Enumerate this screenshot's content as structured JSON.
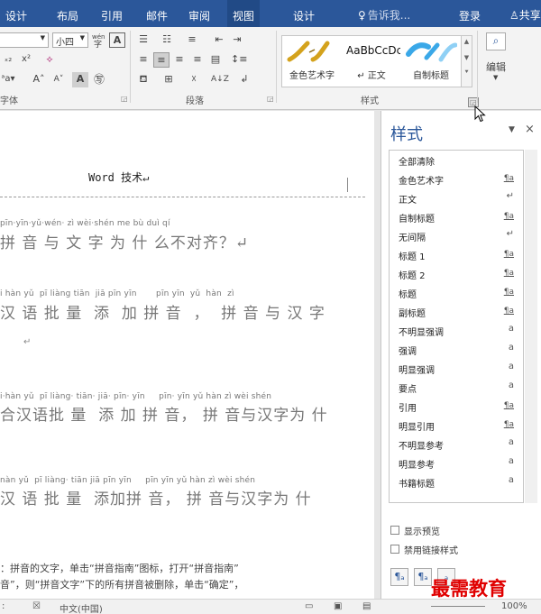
{
  "tabs": [
    "设计",
    "布局",
    "引用",
    "邮件",
    "审阅",
    "视图"
  ],
  "context_tab": "设计",
  "tell_me": {
    "icon": "lightbulb-icon",
    "placeholder": "告诉我..."
  },
  "login": "登录",
  "share": {
    "icon": "person-icon",
    "label": "共享"
  },
  "ribbon": {
    "font_size": "小四",
    "phonetic_guide": "wén",
    "char_border": "A",
    "font_group_label": "字体",
    "paragraph_group_label": "段落",
    "styles_group_label": "样式",
    "editing_label": "编辑",
    "gallery": [
      {
        "caption": "金色艺术字",
        "preview": ""
      },
      {
        "caption": "↵ 正文",
        "preview": "AaBbCcDc"
      },
      {
        "caption": "自制标题",
        "preview": ""
      }
    ]
  },
  "document": {
    "title": "Word 技术↵",
    "lines": [
      {
        "pinyin": "pīn·yīn·yǔ·wén· zì wèi·shén me bù duì qí",
        "hanzi": "拼 音 与 文 字 为 什 么不对齐？↵"
      },
      {
        "pinyin": "i hàn yǔ  pī liàng tiān  jiā pīn yīn       pīn yīn  yǔ  hàn  zì",
        "hanzi": "汉 语 批 量  添  加 拼 音  ，  拼 音 与 汉 字"
      },
      {
        "pinyin": "i·hàn yǔ  pī liàng· tiān· jiā· pīn· yīn     pīn· yīn yǔ hàn zì wèi shén",
        "hanzi": "合汉语批 量  添 加 拼 音， 拼 音与汉字为 什"
      },
      {
        "pinyin": "nàn yǔ  pī liàng· tiān jiā pīn yīn     pīn yīn yǔ hàn zì wèi shén",
        "hanzi": "汉 语 批 量  添加拼 音， 拼 音与汉字为 什"
      }
    ],
    "return_mark": "↵",
    "para1": "：拼音的文字，单击“拼音指南”图标，打开“拼音指南”",
    "para2": "音”，则“拼音文字”下的所有拼音被删除，单击“确定”，"
  },
  "styles_pane": {
    "title": "样式",
    "items": [
      {
        "name": "全部清除",
        "mark": ""
      },
      {
        "name": "金色艺术字",
        "mark": "¶a"
      },
      {
        "name": "正文",
        "mark": "↵"
      },
      {
        "name": "自制标题",
        "mark": "¶a"
      },
      {
        "name": "无间隔",
        "mark": "↵"
      },
      {
        "name": "标题 1",
        "mark": "¶a"
      },
      {
        "name": "标题 2",
        "mark": "¶a"
      },
      {
        "name": "标题",
        "mark": "¶a"
      },
      {
        "name": "副标题",
        "mark": "¶a"
      },
      {
        "name": "不明显强调",
        "mark": "a"
      },
      {
        "name": "强调",
        "mark": "a"
      },
      {
        "name": "明显强调",
        "mark": "a"
      },
      {
        "name": "要点",
        "mark": "a"
      },
      {
        "name": "引用",
        "mark": "¶a"
      },
      {
        "name": "明显引用",
        "mark": "¶a"
      },
      {
        "name": "不明显参考",
        "mark": "a"
      },
      {
        "name": "明显参考",
        "mark": "a"
      },
      {
        "name": "书籍标题",
        "mark": "a"
      }
    ],
    "show_preview": "显示预览",
    "disable_linked": "禁用链接样式"
  },
  "statusbar": {
    "language": "中文(中国)",
    "zoom": "100%"
  },
  "watermark": "最需教育",
  "colors": {
    "ribbon_blue": "#2b579a",
    "watermark_red": "#e00000"
  }
}
